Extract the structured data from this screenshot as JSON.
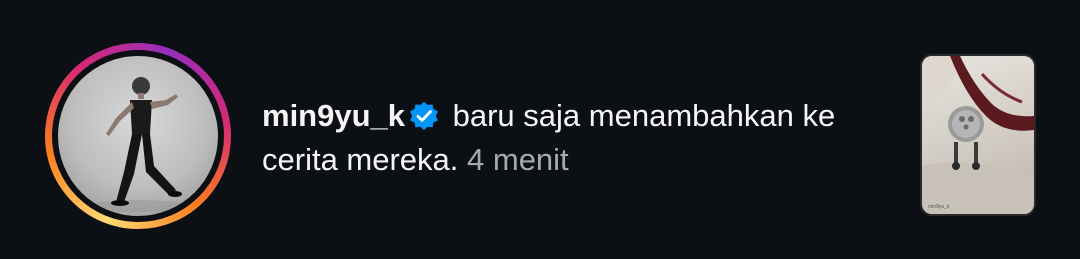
{
  "notification": {
    "username": "min9yu_k",
    "action_text": "baru saja menambahkan ke cerita mereka.",
    "time_ago": "4 menit",
    "verified": true,
    "thumbnail_watermark": "min9yu_k"
  },
  "colors": {
    "background": "#0c1014",
    "text": "#f5f5f5",
    "muted": "#a8a8b3",
    "verified_badge": "#0095f6"
  }
}
